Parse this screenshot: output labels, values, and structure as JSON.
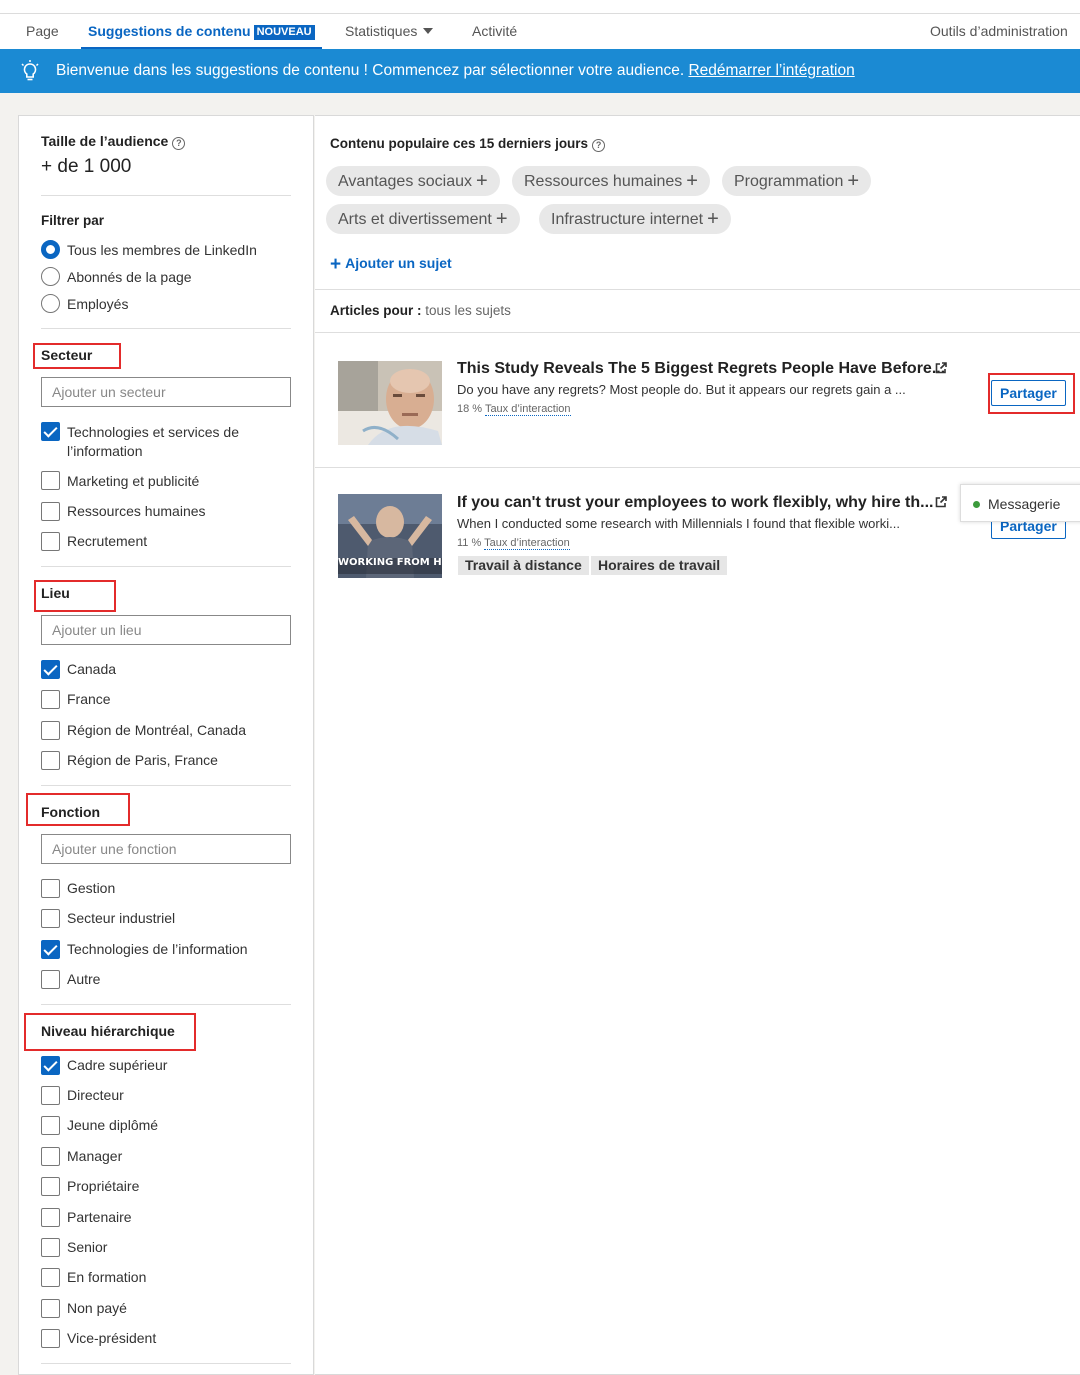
{
  "nav": {
    "tabs": [
      "Page",
      "Suggestions de contenu",
      "Statistiques",
      "Activité"
    ],
    "badge": "NOUVEAU",
    "admin": "Outils d’administration"
  },
  "banner": {
    "text": "Bienvenue dans les suggestions de contenu ! Commencez par sélectionner votre audience.",
    "link": "Redémarrer l’intégration"
  },
  "sidebar": {
    "audience_label": "Taille de l’audience",
    "audience_value": "+ de 1 000",
    "filter_label": "Filtrer par",
    "filter_options": [
      {
        "label": "Tous les membres de LinkedIn",
        "selected": true
      },
      {
        "label": "Abonnés de la page",
        "selected": false
      },
      {
        "label": "Employés",
        "selected": false
      }
    ],
    "sector": {
      "title": "Secteur",
      "placeholder": "Ajouter un secteur",
      "items": [
        {
          "label": "Technologies et services de",
          "label2": "l’information",
          "checked": true
        },
        {
          "label": "Marketing et publicité",
          "checked": false
        },
        {
          "label": "Ressources humaines",
          "checked": false
        },
        {
          "label": "Recrutement",
          "checked": false
        }
      ]
    },
    "location": {
      "title": "Lieu",
      "placeholder": "Ajouter un lieu",
      "items": [
        {
          "label": "Canada",
          "checked": true
        },
        {
          "label": "France",
          "checked": false
        },
        {
          "label": "Région de Montréal, Canada",
          "checked": false
        },
        {
          "label": "Région de Paris, France",
          "checked": false
        }
      ]
    },
    "function": {
      "title": "Fonction",
      "placeholder": "Ajouter une fonction",
      "items": [
        {
          "label": "Gestion",
          "checked": false
        },
        {
          "label": "Secteur industriel",
          "checked": false
        },
        {
          "label": "Technologies de l’information",
          "checked": true
        },
        {
          "label": "Autre",
          "checked": false
        }
      ]
    },
    "seniority": {
      "title": "Niveau hiérarchique",
      "items": [
        {
          "label": "Cadre supérieur",
          "checked": true
        },
        {
          "label": "Directeur",
          "checked": false
        },
        {
          "label": "Jeune diplômé",
          "checked": false
        },
        {
          "label": "Manager",
          "checked": false
        },
        {
          "label": "Propriétaire",
          "checked": false
        },
        {
          "label": "Partenaire",
          "checked": false
        },
        {
          "label": "Senior",
          "checked": false
        },
        {
          "label": "En formation",
          "checked": false
        },
        {
          "label": "Non payé",
          "checked": false
        },
        {
          "label": "Vice-président",
          "checked": false
        }
      ]
    }
  },
  "main": {
    "popular_title": "Contenu populaire ces 15 derniers jours",
    "topics": [
      "Avantages sociaux",
      "Ressources humaines",
      "Programmation",
      "Arts et divertissement",
      "Infrastructure internet"
    ],
    "add_topic": "Ajouter un sujet",
    "articles_label": "Articles pour :",
    "articles_scope": "tous les sujets",
    "articles": [
      {
        "title": "This Study Reveals The 5 Biggest Regrets People Have Before...",
        "desc": "Do you have any regrets? Most people do. But it appears our regrets gain a ...",
        "rate_value": "18 %",
        "rate_label": "Taux d’interaction",
        "share": "Partager",
        "tags": []
      },
      {
        "title": "If you can't trust your employees to work flexibly, why hire th...",
        "desc": "When I conducted some research with Millennials I found that flexible worki...",
        "rate_value": "11 %",
        "rate_label": "Taux d’interaction",
        "share": "Partager",
        "image_caption": "WORKING FROM HOME",
        "tags": [
          "Travail à distance",
          "Horaires de travail"
        ]
      }
    ],
    "messaging": "Messagerie"
  },
  "colors": {
    "accent": "#0a66c2",
    "banner": "#1b8ad3",
    "highlight": "#e32b2b"
  }
}
